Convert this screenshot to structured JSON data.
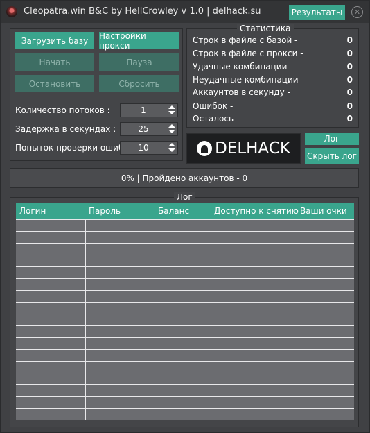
{
  "window": {
    "title": "Cleopatra.win B&C by HellCrowley v 1.0 | delhack.su",
    "results_label": "Результаты",
    "close_glyph": "✕"
  },
  "controls": {
    "load_base": "Загрузить базу",
    "proxy_settings": "Настройки прокси",
    "start": "Начать",
    "pause": "Пауза",
    "stop": "Остановить",
    "reset": "Сбросить",
    "threads_label": "Количество потоков :",
    "threads_value": "1",
    "delay_label": "Задержка в секундах :",
    "delay_value": "25",
    "retries_label": "Попыток проверки ошибки :",
    "retries_value": "10"
  },
  "stats": {
    "title": "Статистика",
    "rows": [
      {
        "label": "Строк в файле с базой -",
        "value": "0"
      },
      {
        "label": "Строк в файле с прокси -",
        "value": "0"
      },
      {
        "label": "Удачные комбинации -",
        "value": "0"
      },
      {
        "label": "Неудачные комбинации -",
        "value": "0"
      },
      {
        "label": "Аккаунтов в секунду -",
        "value": "0"
      },
      {
        "label": "Ошибок -",
        "value": "0"
      },
      {
        "label": "Осталось -",
        "value": "0"
      }
    ]
  },
  "banner": {
    "text": "DELHACK"
  },
  "log_buttons": {
    "log": "Лог",
    "hide_log": "Скрыть лог"
  },
  "progress": {
    "text": "0% | Пройдено аккаунтов - 0",
    "percent": 0
  },
  "log": {
    "title": "Лог",
    "columns": [
      "Логин",
      "Пароль",
      "Баланс",
      "Доступно к снятию",
      "Ваши очки"
    ],
    "rows": []
  },
  "colors": {
    "accent": "#3aa58d",
    "background": "#404144",
    "table_bg": "#6b6c70"
  }
}
